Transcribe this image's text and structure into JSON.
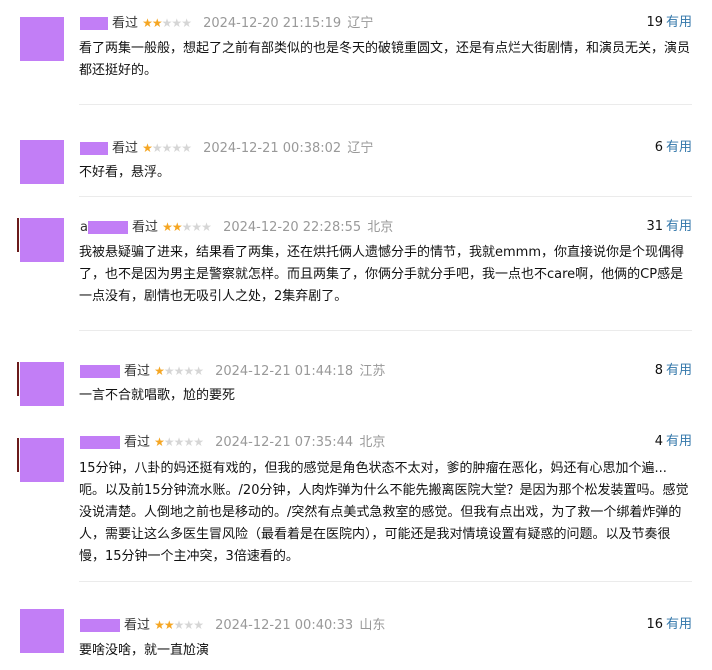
{
  "useful_label": "有用",
  "watched_label": "看过",
  "colors": {
    "avatar": "#c27ef6",
    "star_on": "#f5a623",
    "star_off": "#d6d6d6",
    "link": "#3377aa"
  },
  "reviews": [
    {
      "status": "看过",
      "rating": 2,
      "time": "2024-12-20 21:15:19",
      "location": "辽宁",
      "useful_count": "19",
      "content": "看了两集一般般，想起了之前有部类似的也是冬天的破镜重圆文，还是有点烂大街剧情，和演员无关，演员都还挺好的。"
    },
    {
      "status": "看过",
      "rating": 1,
      "time": "2024-12-21 00:38:02",
      "location": "辽宁",
      "useful_count": "6",
      "content": "不好看，悬浮。"
    },
    {
      "user_initial": "a",
      "status": "看过",
      "rating": 2,
      "time": "2024-12-20 22:28:55",
      "location": "北京",
      "useful_count": "31",
      "content": "我被悬疑骗了进来，结果看了两集，还在烘托俩人遗憾分手的情节，我就emmm，你直接说你是个现偶得了，也不是因为男主是警察就怎样。而且两集了，你俩分手就分手吧，我一点也不care啊，他俩的CP感是一点没有，剧情也无吸引人之处，2集弃剧了。"
    },
    {
      "status": "看过",
      "rating": 1,
      "time": "2024-12-21 01:44:18",
      "location": "江苏",
      "useful_count": "8",
      "content": "一言不合就唱歌，尬的要死"
    },
    {
      "status": "看过",
      "rating": 1,
      "time": "2024-12-21 07:35:44",
      "location": "北京",
      "useful_count": "4",
      "content": "15分钟，八卦的妈还挺有戏的，但我的感觉是角色状态不太对，爹的肿瘤在恶化，妈还有心思加个遍...呃。以及前15分钟流水账。/20分钟，人肉炸弹为什么不能先搬离医院大堂？是因为那个松发装置吗。感觉没说清楚。人倒地之前也是移动的。/突然有点美式急救室的感觉。但我有点出戏，为了救一个绑着炸弹的人，需要让这么多医生冒风险（最看着是在医院内），可能还是我对情境设置有疑惑的问题。以及节奏很慢，15分钟一个主冲突，3倍速看的。"
    },
    {
      "status": "看过",
      "rating": 2,
      "time": "2024-12-21 00:40:33",
      "location": "山东",
      "useful_count": "16",
      "content": "要啥没啥，就一直尬演"
    }
  ]
}
